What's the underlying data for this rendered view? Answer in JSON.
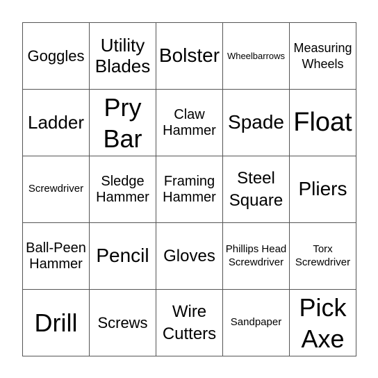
{
  "card": {
    "rows": [
      [
        "Goggles",
        "Utility Blades",
        "Bolster",
        "Wheelbarrows",
        "Measuring Wheels"
      ],
      [
        "Ladder",
        "Pry Bar",
        "Claw Hammer",
        "Spade",
        "Float"
      ],
      [
        "Screwdriver",
        "Sledge Hammer",
        "Framing Hammer",
        "Steel Square",
        "Pliers"
      ],
      [
        "Ball-Peen Hammer",
        "Pencil",
        "Gloves",
        "Phillips Head Screwdriver",
        "Torx Screwdriver"
      ],
      [
        "Drill",
        "Screws",
        "Wire Cutters",
        "Sandpaper",
        "Pick Axe"
      ]
    ]
  }
}
